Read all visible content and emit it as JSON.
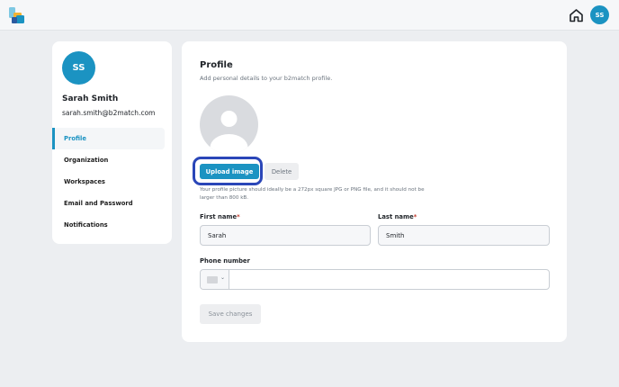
{
  "header": {
    "logo_icon": "b2match-logo-icon",
    "home_icon": "home-icon",
    "avatar_initials": "SS"
  },
  "sidebar": {
    "avatar_initials": "SS",
    "name": "Sarah Smith",
    "email": "sarah.smith@b2match.com",
    "items": [
      {
        "label": "Profile",
        "active": true
      },
      {
        "label": "Organization"
      },
      {
        "label": "Workspaces"
      },
      {
        "label": "Email and Password"
      },
      {
        "label": "Notifications"
      }
    ]
  },
  "profile": {
    "title": "Profile",
    "subtitle": "Add personal details to your b2match profile.",
    "upload_label": "Upload image",
    "delete_label": "Delete",
    "hint": "Your profile picture should ideally be a 272px square JPG or PNG file, and it should not be larger than 800 kB.",
    "first_name_label": "First name",
    "first_name_value": "Sarah",
    "last_name_label": "Last name",
    "last_name_value": "Smith",
    "required_mark": "*",
    "phone_label": "Phone number",
    "phone_value": "",
    "save_label": "Save changes"
  },
  "colors": {
    "accent": "#1b93c2",
    "highlight": "#2a46b8",
    "required": "#c0392b"
  }
}
